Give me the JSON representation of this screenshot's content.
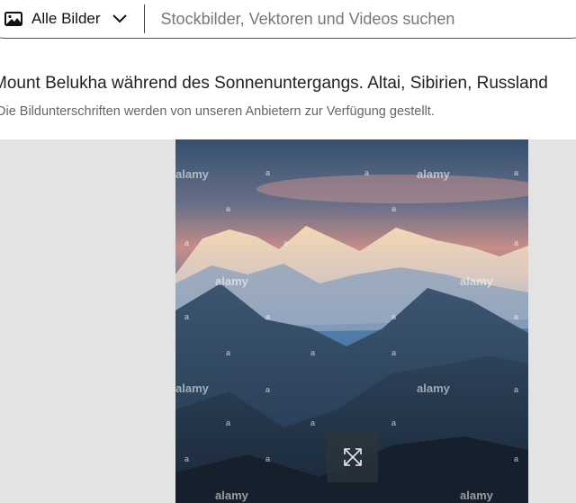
{
  "search": {
    "filter_label": "Alle Bilder",
    "placeholder": "Stockbilder, Vektoren und Videos suchen",
    "filter_icon": "image-icon",
    "dropdown_icon": "chevron-down-icon"
  },
  "caption": {
    "title": "Mount Belukha während des Sonnenuntergangs. Altai, Sibirien, Russland",
    "note": "Die Bildunterschriften werden von unseren Anbietern zur Verfügung gestellt."
  },
  "viewer": {
    "watermark": "alamy",
    "watermark_small": "a",
    "expand_icon": "expand-icon"
  },
  "colors": {
    "viewer_bg": "#e3e3e3",
    "border": "#555555"
  }
}
